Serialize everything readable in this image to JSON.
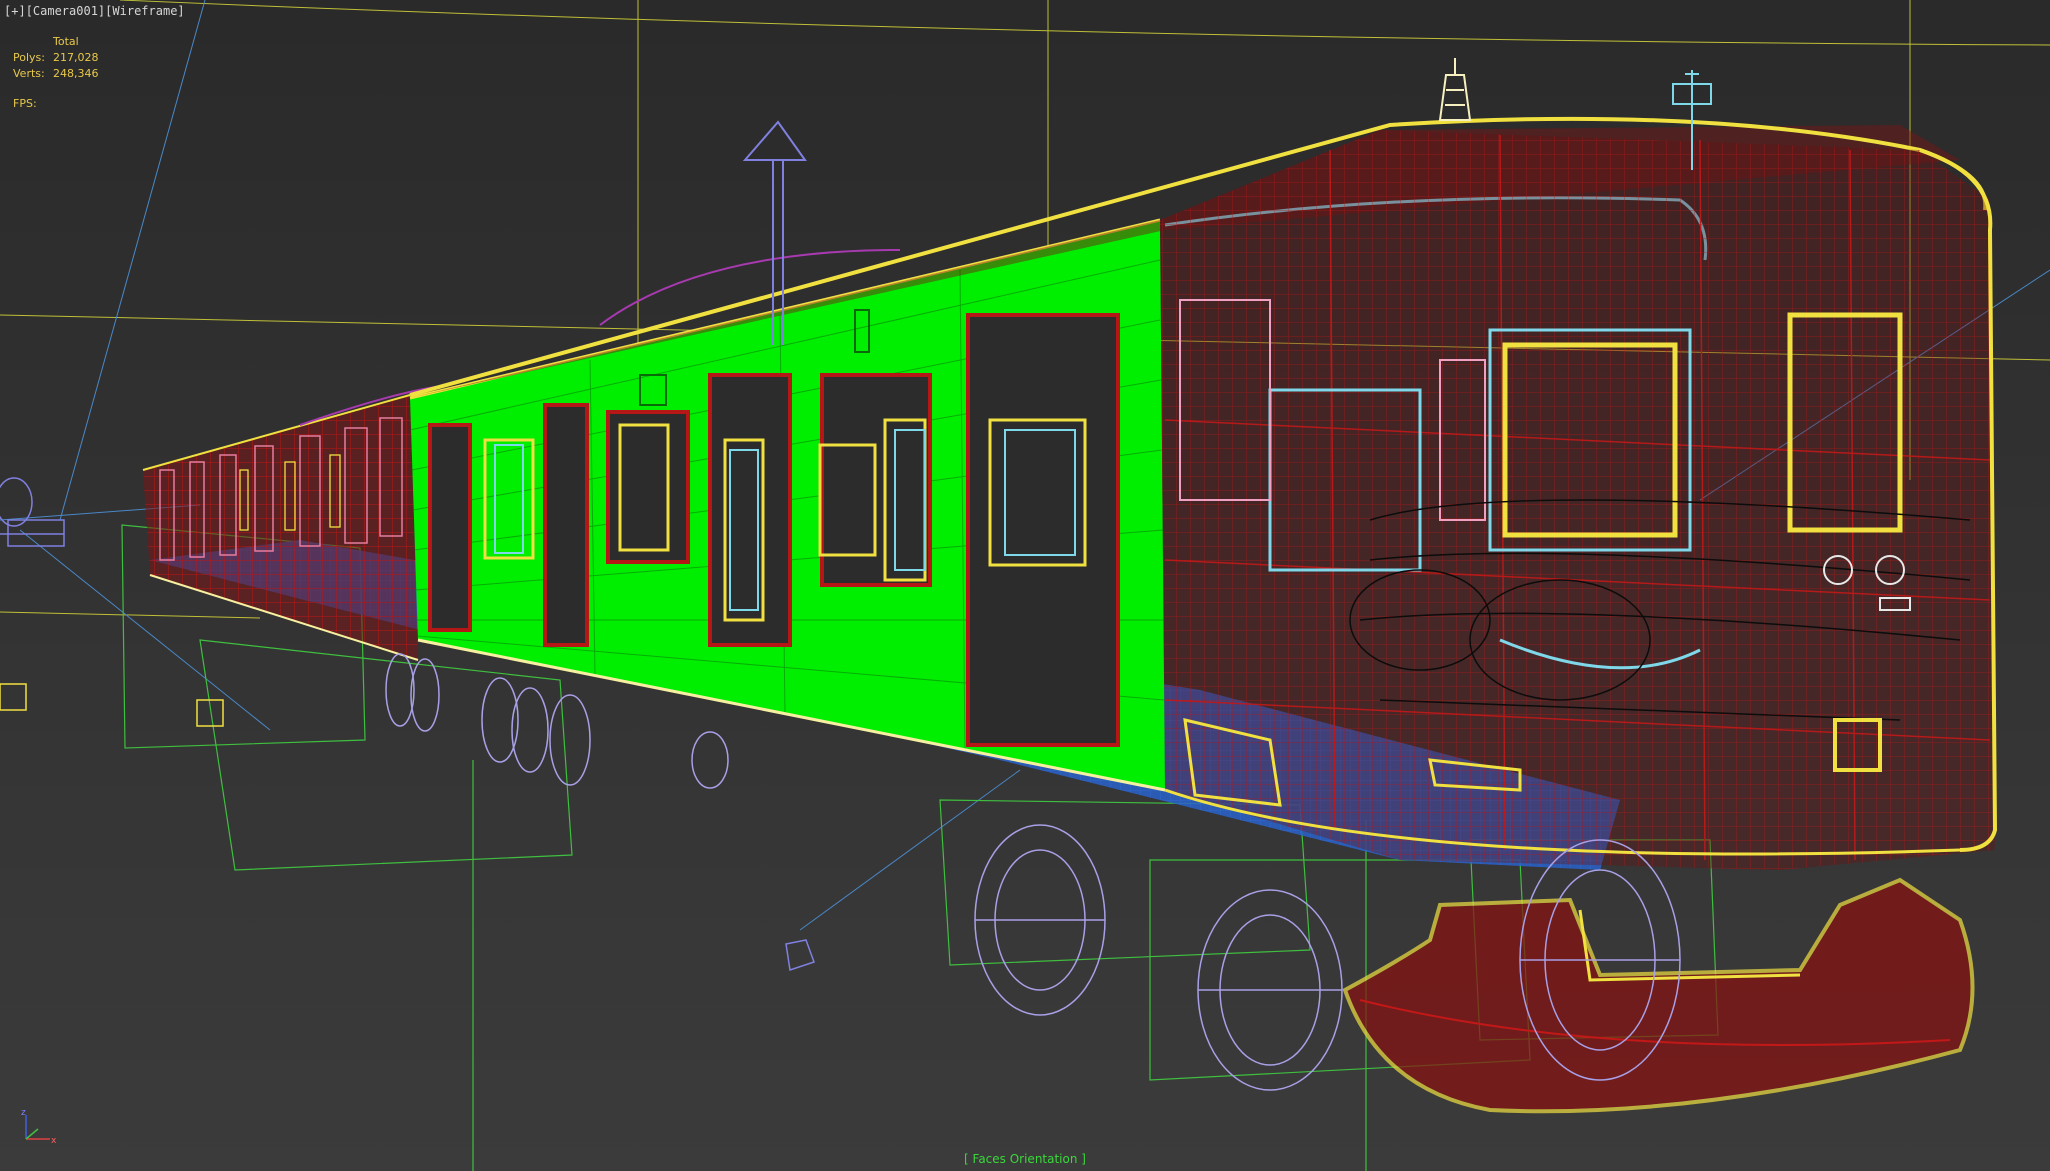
{
  "viewport": {
    "label": {
      "menu": "[+]",
      "camera": "[Camera001]",
      "shading": "[Wireframe]"
    },
    "stats": {
      "header": "Total",
      "polys_label": "Polys:",
      "polys_value": "217,028",
      "verts_label": "Verts:",
      "verts_value": "248,346",
      "fps_label": "FPS:"
    },
    "mode_label": "[ Faces Orientation ]",
    "axis": {
      "x": "x",
      "y": "y",
      "z": "z"
    }
  },
  "colors": {
    "background": "#2e2e2e",
    "green_faces": "#00ee00",
    "red_wire": "#c21818",
    "yellow_outline": "#f0e040",
    "cyan_wire": "#7fd8ea",
    "lavender_wheels": "#a8a0e6",
    "blue_undercarriage": "#2a62c9",
    "grid_line": "#cfcf3a",
    "helper_green": "#3fbf3f"
  }
}
